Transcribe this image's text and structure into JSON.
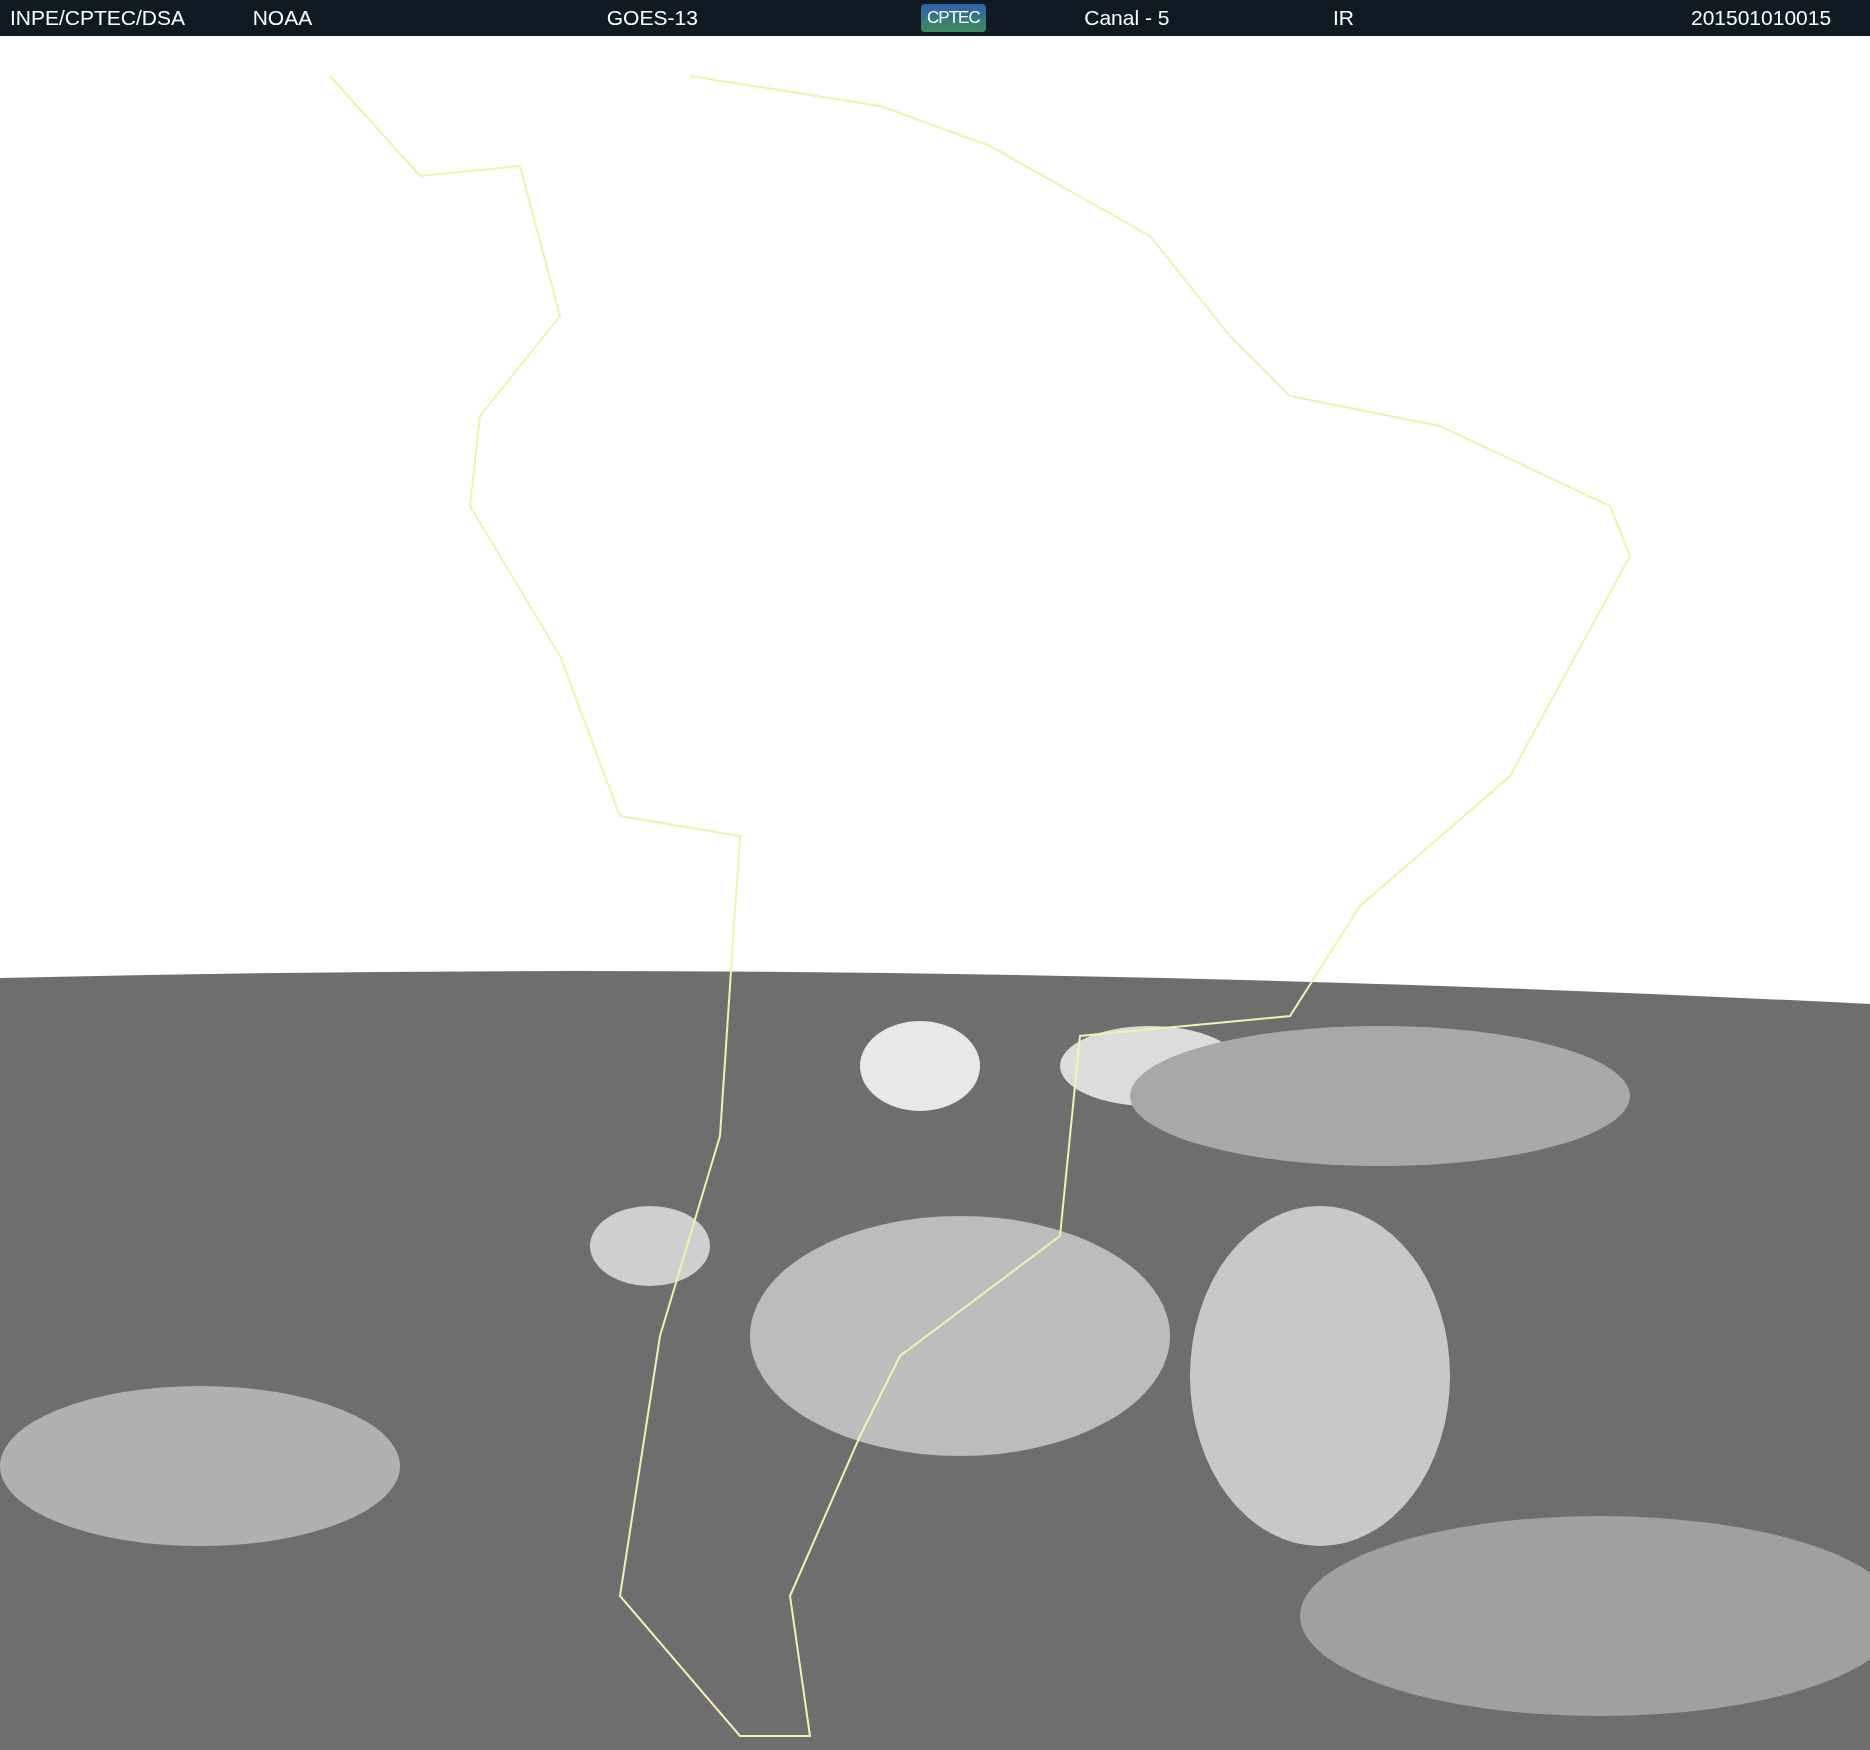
{
  "header": {
    "items": [
      {
        "text": "INPE/CPTEC/DSA",
        "kind": "text"
      },
      {
        "text": "NOAA",
        "kind": "text"
      },
      {
        "text": "GOES-13",
        "kind": "text"
      },
      {
        "text": "CPTEC",
        "kind": "logo"
      },
      {
        "text": "Canal - 5",
        "kind": "text"
      },
      {
        "text": "IR",
        "kind": "text"
      },
      {
        "text": "201501010015",
        "kind": "text"
      }
    ]
  }
}
